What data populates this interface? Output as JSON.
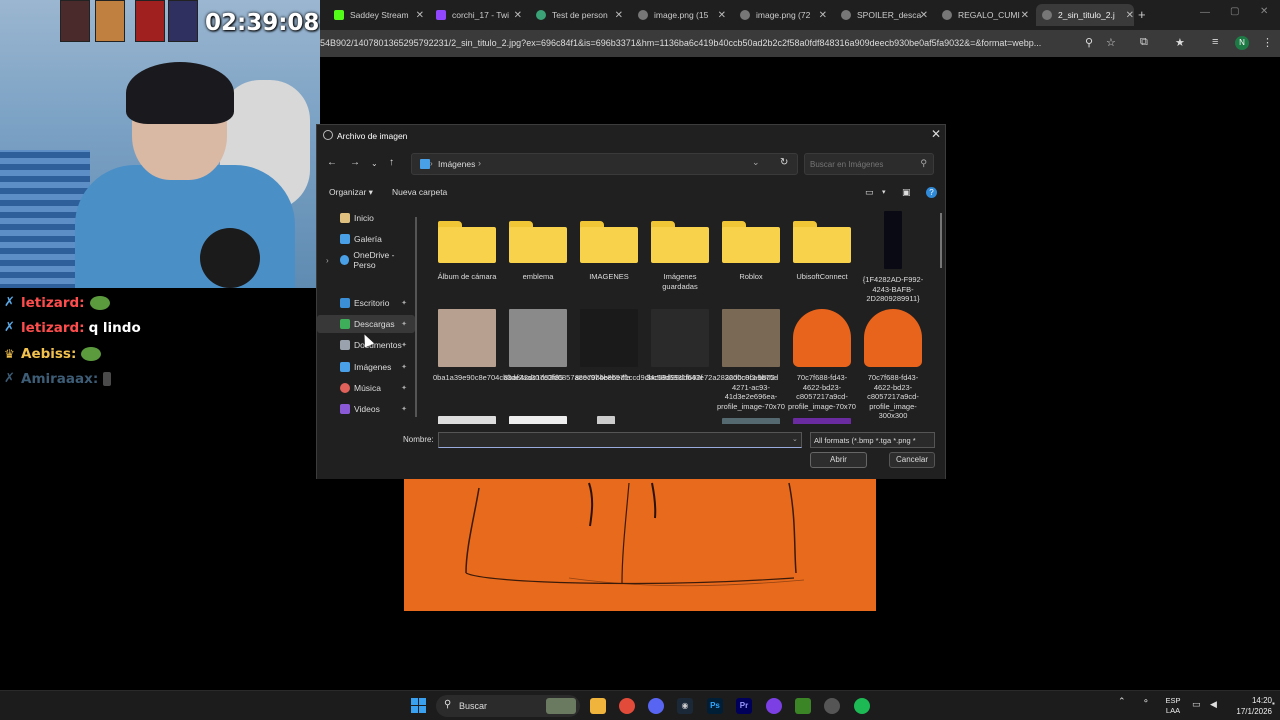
{
  "stream": {
    "timer": "02:39:08",
    "chat": [
      {
        "user": "letizard:",
        "message": "",
        "user_color": "#ff4d4d",
        "badge_color": "#5aa9e6",
        "emote": true
      },
      {
        "user": "letizard:",
        "message": "q lindo",
        "user_color": "#ff4d4d",
        "badge_color": "#5aa9e6",
        "emote": false
      },
      {
        "user": "Aebiss:",
        "message": "",
        "user_color": "#f2c14e",
        "badge_color": "#f2c14e",
        "emote": true
      },
      {
        "user": "Amiraaax:",
        "message": "",
        "user_color": "#6fa8d6",
        "badge_color": "#6fa8d6",
        "emote": true
      }
    ]
  },
  "browser": {
    "tabs": [
      {
        "label": "Saddey Stream",
        "icon_color": "#53fc18"
      },
      {
        "label": "corchi_17 - Twi",
        "icon_color": "#9146ff"
      },
      {
        "label": "Test de person",
        "icon_color": "#3aa276"
      },
      {
        "label": "image.png (15",
        "icon_color": "#888888"
      },
      {
        "label": "image.png (72",
        "icon_color": "#888888"
      },
      {
        "label": "SPOILER_desca",
        "icon_color": "#888888"
      },
      {
        "label": "REGALO_CUMI",
        "icon_color": "#888888"
      },
      {
        "label": "2_sin_titulo_2.j",
        "icon_color": "#888888"
      }
    ],
    "url": "54B902/1407801365295792231/2_sin_titulo_2.jpg?ex=696c84f1&is=696b3371&hm=1136ba6c419b40ccb50ad2b2c2f58a0fdf848316a909deecb930be0af5fa9032&=&format=webp...",
    "profile_initial": "N"
  },
  "dialog": {
    "title": "Archivo de imagen",
    "breadcrumb": "Imágenes",
    "search_placeholder": "Buscar en Imágenes",
    "organize": "Organizar ▾",
    "new_folder": "Nueva carpeta",
    "nav": [
      {
        "label": "Inicio",
        "icon": "home-icon",
        "color": "#e0c080",
        "pinned": false
      },
      {
        "label": "Galería",
        "icon": "gallery-icon",
        "color": "#4aa0e6",
        "pinned": false
      },
      {
        "label": "OneDrive - Perso",
        "icon": "cloud-icon",
        "color": "#4aa0e6",
        "pinned": false,
        "expandable": true
      },
      {
        "label": "Escritorio",
        "icon": "desktop-icon",
        "color": "#3a8fd6",
        "pinned": true
      },
      {
        "label": "Descargas",
        "icon": "download-icon",
        "color": "#3fae5a",
        "pinned": true,
        "selected": true
      },
      {
        "label": "Documentos",
        "icon": "document-icon",
        "color": "#9aa3ad",
        "pinned": true
      },
      {
        "label": "Imágenes",
        "icon": "pictures-icon",
        "color": "#4aa0e6",
        "pinned": true
      },
      {
        "label": "Música",
        "icon": "music-icon",
        "color": "#e0605a",
        "pinned": true
      },
      {
        "label": "Videos",
        "icon": "video-icon",
        "color": "#8a5ad6",
        "pinned": true
      }
    ],
    "folders": [
      {
        "label": "Álbum de cámara"
      },
      {
        "label": "emblema"
      },
      {
        "label": "IMAGENES"
      },
      {
        "label": "Imágenes guardadas"
      },
      {
        "label": "Roblox"
      },
      {
        "label": "UbisoftConnect"
      },
      {
        "label": "{1F4282AD-F992-4243-BAFB-2D2809289911}"
      }
    ],
    "images": [
      {
        "label": "0ba1a39e90c8e704cb3de42dc1d93f85",
        "color": "#b8a090"
      },
      {
        "label": "8baf2aa307c0fd6857a89c974e8b97fe",
        "color": "#8a8a8a"
      },
      {
        "label": "8ce70bbbe6ed1ccd9dbc58d6931f692f",
        "color": "#1a1a1a"
      },
      {
        "label": "34c68d99ddb43e72a28220bc8ca9b75d",
        "color": "#2a2a2a"
      },
      {
        "label": "36d0c0f3-b802-4271-ac93-41d3e2e696ea-profile_image-70x70",
        "color": "#7a6a55"
      },
      {
        "label": "70c7f688-fd43-4622-bd23-c8057217a9cd-profile_image-70x70",
        "color": "#e8641c"
      },
      {
        "label": "70c7f688-fd43-4622-bd23-c8057217a9cd-profile_image-300x300",
        "color": "#e8641c"
      }
    ],
    "name_label": "Nombre:",
    "name_value": "",
    "filetype": "All formats (*.bmp *.tga *.png *",
    "open": "Abrir",
    "cancel": "Cancelar"
  },
  "taskbar": {
    "search": "Buscar",
    "lang_top": "ESP",
    "lang_bottom": "LAA",
    "time": "14:20",
    "date": "17/1/2026"
  }
}
